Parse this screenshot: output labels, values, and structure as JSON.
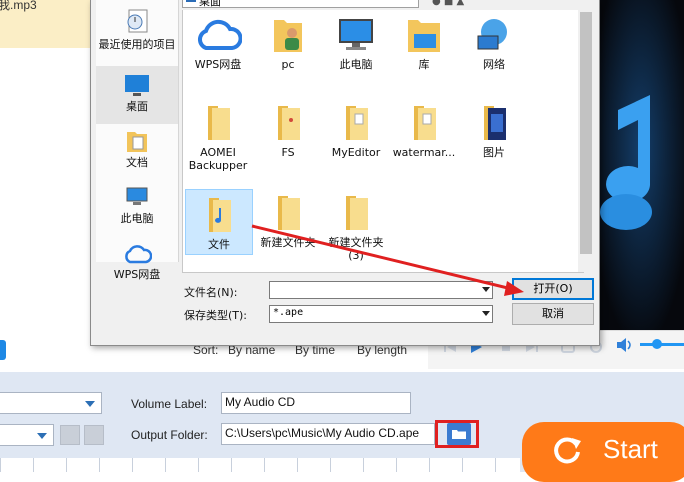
{
  "background": {
    "file_tag": "我.mp3",
    "sort": {
      "label": "Sort:",
      "by_name": "By name",
      "by_time": "By time",
      "by_length": "By length"
    },
    "volume_label": "Volume Label:",
    "volume_value": "My Audio CD",
    "output_folder_label": "Output Folder:",
    "output_folder_value": "C:\\Users\\pc\\Music\\My Audio CD.ape",
    "start_label": "Start"
  },
  "dialog": {
    "address": "桌面",
    "places": [
      {
        "label": "最近使用的项目",
        "icon": "recent-items-icon"
      },
      {
        "label": "桌面",
        "icon": "desktop-icon"
      },
      {
        "label": "文档",
        "icon": "documents-icon"
      },
      {
        "label": "此电脑",
        "icon": "this-pc-icon"
      },
      {
        "label": "WPS网盘",
        "icon": "wps-cloud-icon"
      }
    ],
    "items": [
      {
        "label": "WPS网盘",
        "icon": "wps-cloud-icon"
      },
      {
        "label": "pc",
        "icon": "user-folder-icon"
      },
      {
        "label": "此电脑",
        "icon": "computer-icon"
      },
      {
        "label": "库",
        "icon": "library-icon"
      },
      {
        "label": "网络",
        "icon": "network-icon"
      },
      {
        "label": "AOMEI Backupper",
        "icon": "folder-icon"
      },
      {
        "label": "FS",
        "icon": "folder-icon"
      },
      {
        "label": "MyEditor",
        "icon": "folder-icon"
      },
      {
        "label": "watermar...",
        "icon": "folder-icon"
      },
      {
        "label": "图片",
        "icon": "pictures-folder-icon"
      },
      {
        "label": "文件",
        "icon": "music-folder-icon"
      },
      {
        "label": "新建文件夹",
        "icon": "folder-icon"
      },
      {
        "label": "新建文件夹 (3)",
        "icon": "folder-icon"
      }
    ],
    "filename_label": "文件名(N):",
    "filename_value": "",
    "filetype_label": "保存类型(T):",
    "filetype_value": "*.ape",
    "open_button": "打开(O)",
    "cancel_button": "取消"
  },
  "colors": {
    "accent": "#1e88e5",
    "start": "#ff7a18",
    "annotation": "#e02020"
  }
}
